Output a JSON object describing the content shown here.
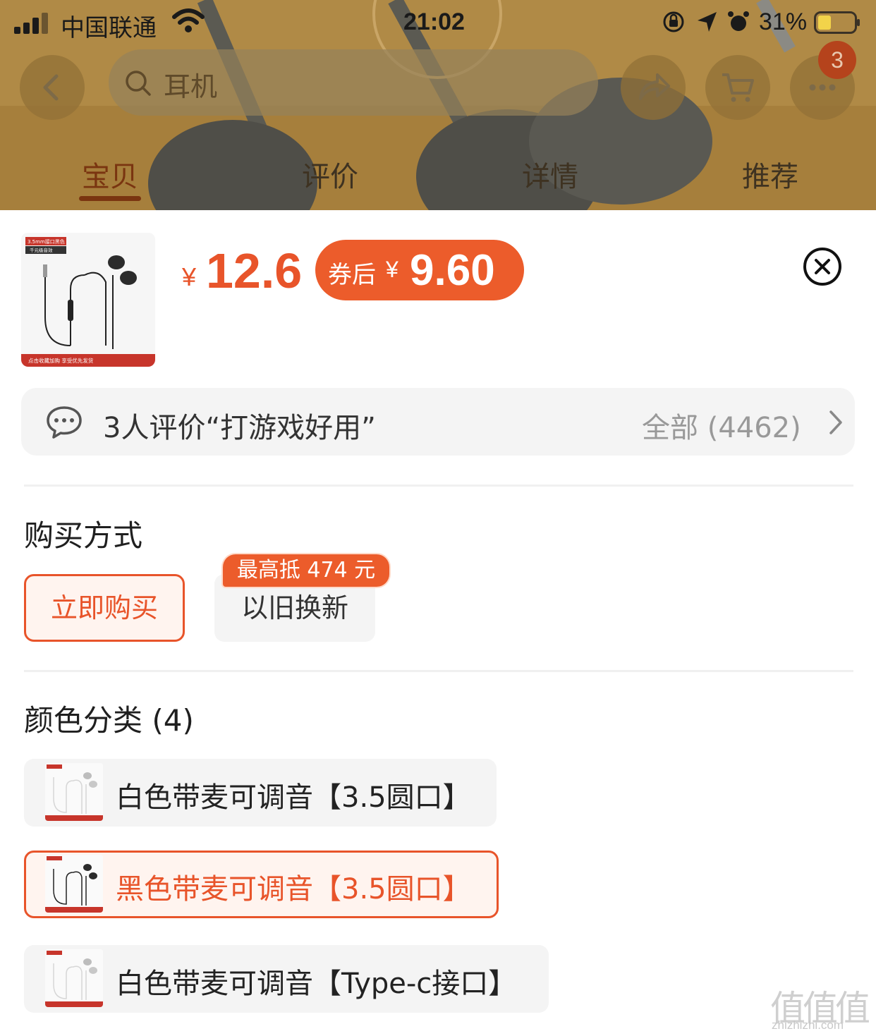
{
  "status_bar": {
    "carrier": "中国联通",
    "time": "21:02",
    "battery_percent": "31%"
  },
  "header": {
    "search_text": "耳机",
    "cart_badge": "3",
    "tabs": [
      {
        "label": "宝贝",
        "active": true
      },
      {
        "label": "评价",
        "active": false
      },
      {
        "label": "详情",
        "active": false
      },
      {
        "label": "推荐",
        "active": false
      }
    ]
  },
  "product": {
    "currency_symbol": "¥",
    "price": "12.6",
    "coupon_label": "券后",
    "coupon_currency": "¥",
    "coupon_price": "9.60",
    "thumb_tag_top": "3.5mm接口黑色",
    "thumb_tag_sub": "千元级音效",
    "thumb_footer": "点击收藏加购  享受优先发货"
  },
  "review": {
    "summary": "3人评价“打游戏好用”",
    "all_label": "全部 (4462)"
  },
  "purchase": {
    "title": "购买方式",
    "options": [
      {
        "label": "立即购买",
        "selected": true
      },
      {
        "label": "以旧换新",
        "selected": false,
        "tag": "最高抵 474 元"
      }
    ]
  },
  "colors": {
    "title": "颜色分类 (4)",
    "items": [
      {
        "label": "白色带麦可调音【3.5圆口】",
        "selected": false
      },
      {
        "label": "黑色带麦可调音【3.5圆口】",
        "selected": true
      },
      {
        "label": "白色带麦可调音【Type-c接口】",
        "selected": false
      }
    ]
  },
  "watermark": {
    "glyphs": "值值值",
    "url": "zhizhizhi.com"
  },
  "theme": {
    "accent": "#e8542a",
    "overlay": "#a8813f"
  }
}
